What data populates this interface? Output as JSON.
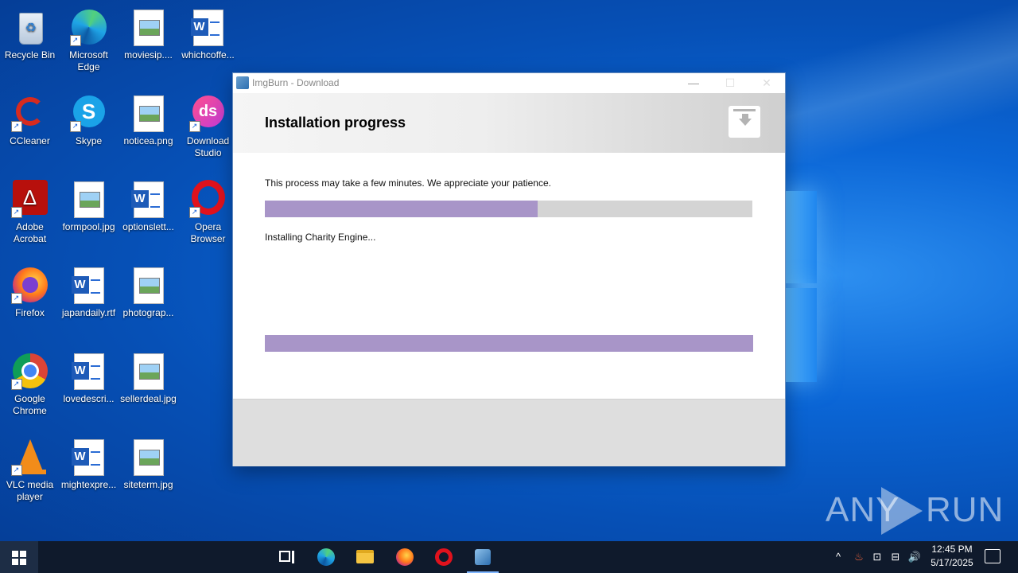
{
  "desktop": {
    "icons": [
      {
        "label": "Recycle Bin"
      },
      {
        "label": "Microsoft Edge"
      },
      {
        "label": "moviesip...."
      },
      {
        "label": "whichcoffe..."
      },
      {
        "label": "CCleaner"
      },
      {
        "label": "Skype"
      },
      {
        "label": "noticea.png"
      },
      {
        "label": "Download Studio"
      },
      {
        "label": "Adobe Acrobat"
      },
      {
        "label": "formpool.jpg"
      },
      {
        "label": "optionslett..."
      },
      {
        "label": "Opera Browser"
      },
      {
        "label": "Firefox"
      },
      {
        "label": "japandaily.rtf"
      },
      {
        "label": "photograp..."
      },
      {
        "label": "Google Chrome"
      },
      {
        "label": "lovedescri..."
      },
      {
        "label": "sellerdeal.jpg"
      },
      {
        "label": "VLC media player"
      },
      {
        "label": "mightexpre..."
      },
      {
        "label": "siteterm.jpg"
      }
    ]
  },
  "window": {
    "title": "ImgBurn - Download",
    "heading": "Installation progress",
    "message": "This process may take a few minutes. We appreciate your patience.",
    "status": "Installing Charity Engine...",
    "overall_progress": 0.56,
    "item_progress": 1.0,
    "controls": {
      "minimize": "—",
      "maximize": "☐",
      "close": "✕"
    }
  },
  "watermark": {
    "left": "ANY",
    "right": "RUN"
  },
  "taskbar": {
    "clock_time": "12:45 PM",
    "clock_date": "5/17/2025"
  },
  "colors": {
    "progress_fill": "#a895c8",
    "progress_track": "#d4d4d4",
    "taskbar": "#0f1a2c"
  }
}
